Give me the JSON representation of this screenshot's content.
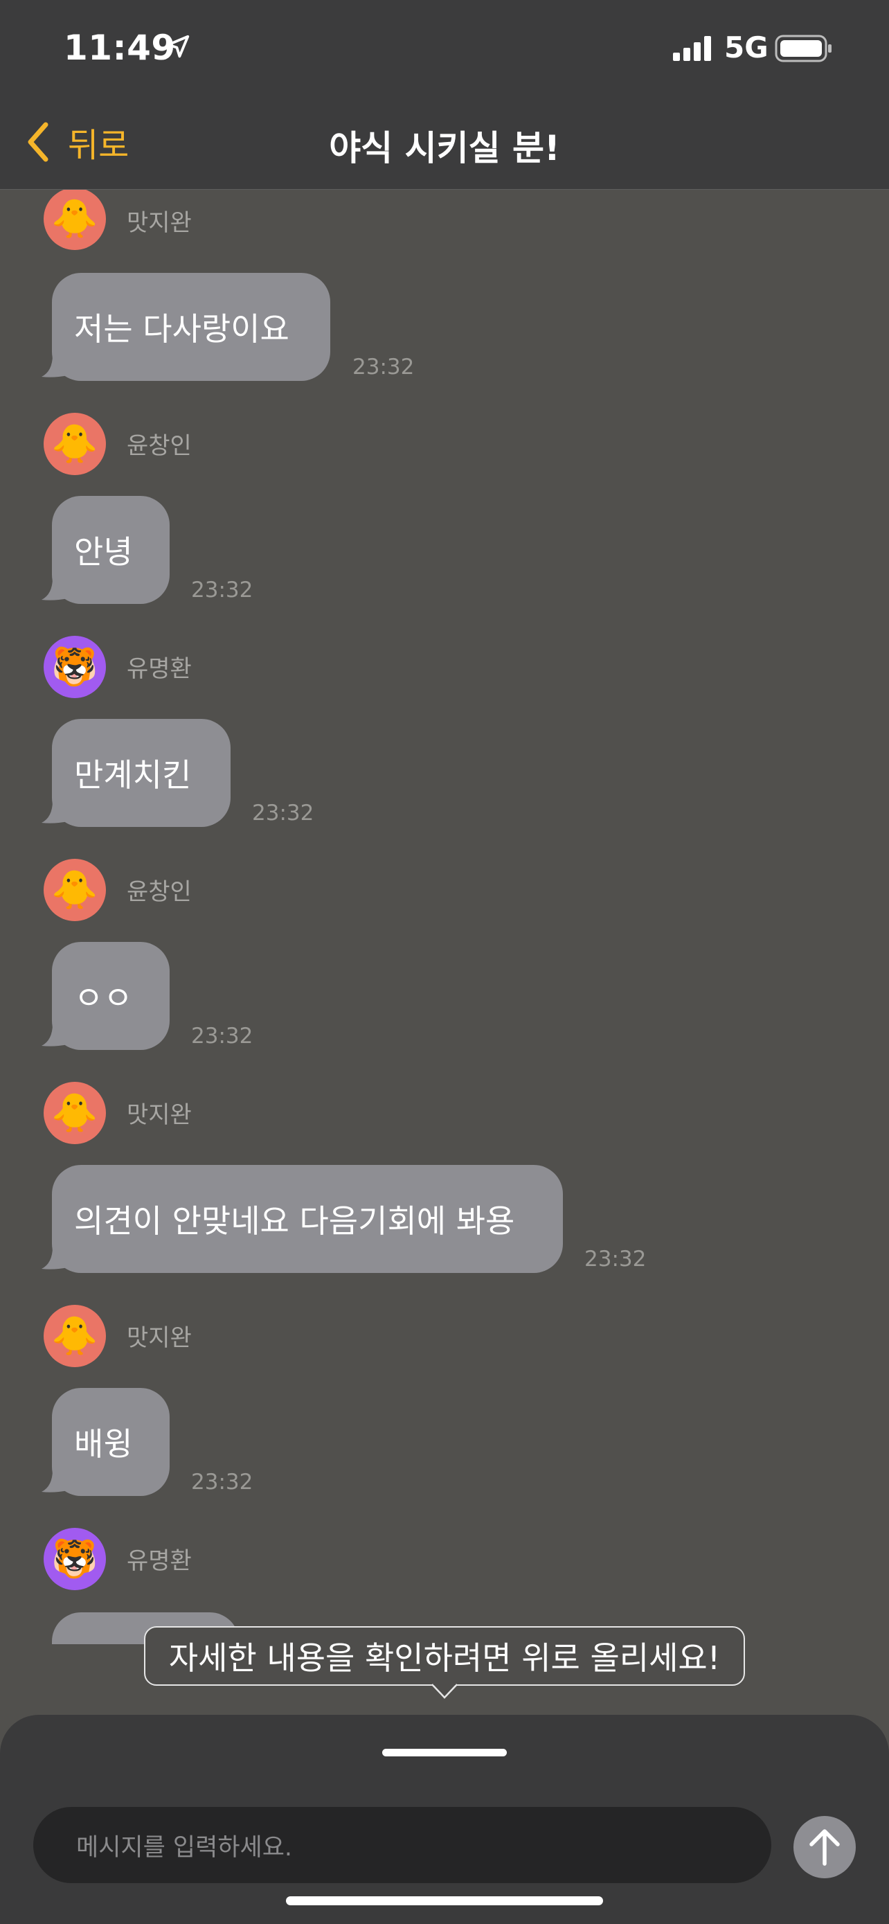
{
  "status_bar": {
    "time": "11:49",
    "network": "5G",
    "icons": [
      "location-arrow-icon",
      "cellular-signal-icon",
      "battery-icon"
    ]
  },
  "nav": {
    "back_label": "뒤로",
    "title": "야식 시키실 분!"
  },
  "messages": [
    {
      "sender": "맛지완",
      "avatar": "🐥",
      "text": "저는 다사랑이요",
      "time": "23:32"
    },
    {
      "sender": "윤창인",
      "avatar": "🐥",
      "text": "안녕",
      "time": "23:32"
    },
    {
      "sender": "유명환",
      "avatar": "🐯",
      "text": "만계치킨",
      "time": "23:32"
    },
    {
      "sender": "윤창인",
      "avatar": "🐥",
      "text": "ㅇㅇ",
      "time": "23:32"
    },
    {
      "sender": "맛지완",
      "avatar": "🐥",
      "text": "의견이 안맞네요 다음기회에 봐용",
      "time": "23:32"
    },
    {
      "sender": "맛지완",
      "avatar": "🐥",
      "text": "배윙",
      "time": "23:32"
    },
    {
      "sender": "유명환",
      "avatar": "🐯",
      "text": "",
      "time": ""
    }
  ],
  "tooltip": {
    "text": "자세한 내용을 확인하려면 위로 올리세요!"
  },
  "composer": {
    "placeholder": "메시지를 입력하세요."
  },
  "colors": {
    "accent": "#f5b52a",
    "bubble": "#8e8e93",
    "background": "#51504d",
    "header": "#3c3c3d",
    "chick_avatar": "#ea7566",
    "tiger_avatar": "#a15bf0"
  }
}
